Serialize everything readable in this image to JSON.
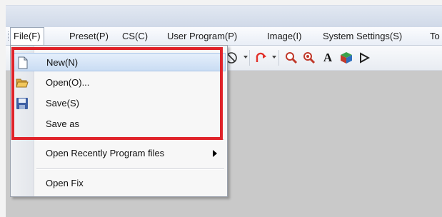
{
  "menubar": {
    "items": [
      {
        "label": "File(F)",
        "active": true
      },
      {
        "label": "Preset(P)"
      },
      {
        "label": "CS(C)"
      },
      {
        "label": "User Program(P)"
      },
      {
        "label": "Image(I)"
      },
      {
        "label": "System Settings(S)"
      },
      {
        "label": "To"
      }
    ]
  },
  "file_menu": {
    "items": [
      {
        "label": "New(N)",
        "icon": "new-file-icon",
        "highlighted": true
      },
      {
        "label": "Open(O)...",
        "icon": "open-folder-icon"
      },
      {
        "label": "Save(S)",
        "icon": "save-disk-icon"
      },
      {
        "label": "Save as"
      },
      {
        "label": "Open Recently Program files",
        "submenu": true
      },
      {
        "label": "Open Fix"
      }
    ]
  },
  "toolbar": {
    "icons": [
      "no-entry-icon",
      "rotate-icon",
      "zoom-in-icon",
      "zoom-out-icon",
      "text-icon",
      "color-cube-icon",
      "play-icon"
    ]
  },
  "colors": {
    "highlight_frame": "#e0232a",
    "menu_highlight": "#c9dcf3",
    "workspace": "#c9c9c9"
  }
}
